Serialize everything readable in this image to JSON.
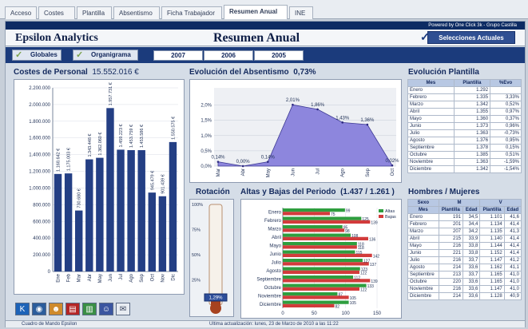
{
  "tabs": [
    "Acceso",
    "Costes",
    "Plantilla",
    "Absentismo",
    "Ficha Trabajador",
    "Resumen Anual",
    "INE"
  ],
  "active_tab": "Resumen Anual",
  "powered_by": "Powered by One Click 3k - Grupo Castilla",
  "app_name": "Epsilon Analytics",
  "page_title": "Resumen Anual",
  "select_button": "Selecciones Actuales",
  "nav": {
    "globales": "Globales",
    "organigrama": "Organigrama",
    "years": [
      "2007",
      "2006",
      "2005"
    ]
  },
  "costes": {
    "title": "Costes de Personal",
    "total": "15.552.016 €",
    "chart_data": {
      "type": "bar",
      "categories": [
        "Ene",
        "Feb",
        "Mar",
        "Abr",
        "May",
        "Jun",
        "Jul",
        "Ago",
        "Sep",
        "Oct",
        "Nov",
        "Dic"
      ],
      "values": [
        1168642,
        1175003,
        730680,
        1343448,
        1362060,
        1957731,
        1459223,
        1453759,
        1453586,
        945479,
        901439,
        1550575
      ],
      "labels": [
        "1.168.642 €",
        "1.175.003 €",
        "730.680 €",
        "1.343.448 €",
        "1.362.060 €",
        "1.957.731 €",
        "1.459.223 €",
        "1.453.759 €",
        "1.453.586 €",
        "945.479 €",
        "901.439 €",
        "1.550.575 €"
      ],
      "yticks": [
        "0",
        "200.000",
        "400.000",
        "600.000",
        "800.000",
        "1.000.000",
        "1.200.000",
        "1.400.000",
        "1.600.000",
        "1.800.000",
        "2.000.000",
        "2.200.000"
      ],
      "ylim": [
        0,
        2200000
      ]
    }
  },
  "absentismo": {
    "title": "Evolución del Absentismo",
    "value": "0,73%",
    "chart_data": {
      "type": "area",
      "categories": [
        "Mar",
        "Abr",
        "May",
        "Jun",
        "Jul",
        "Ago",
        "Sep",
        "Oct"
      ],
      "values": [
        0.14,
        0.0,
        0.14,
        2.01,
        1.86,
        1.43,
        1.36,
        0.02
      ],
      "labels": [
        "0,14%",
        "0,00%",
        "0,14%",
        "2,01%",
        "1,86%",
        "1,43%",
        "1,36%",
        "0,02%"
      ],
      "yticks": [
        "0,0%",
        "0,5%",
        "1,0%",
        "1,5%",
        "2,0%"
      ],
      "ylim": [
        0,
        2.0
      ]
    }
  },
  "plantilla": {
    "title": "Evolución Plantilla",
    "headers": [
      "Mes",
      "Plantilla",
      "%Evo"
    ],
    "rows": [
      [
        "Enero",
        "1.292",
        ""
      ],
      [
        "Febrero",
        "1.335",
        "3,33%"
      ],
      [
        "Marzo",
        "1.342",
        "0,52%"
      ],
      [
        "Abril",
        "1.355",
        "0,97%"
      ],
      [
        "Mayo",
        "1.360",
        "0,37%"
      ],
      [
        "Junio",
        "1.373",
        "0,96%"
      ],
      [
        "Julio",
        "1.363",
        "-0,73%"
      ],
      [
        "Agosto",
        "1.376",
        "0,95%"
      ],
      [
        "Septiembre",
        "1.378",
        "0,15%"
      ],
      [
        "Octubre",
        "1.385",
        "0,51%"
      ],
      [
        "Noviembre",
        "1.363",
        "-1,59%"
      ],
      [
        "Diciembre",
        "1.342",
        "-1,54%"
      ]
    ]
  },
  "rotacion": {
    "title": "Rotación",
    "ticks": [
      "100%",
      "75%",
      "50%",
      "25%"
    ],
    "value": "1,29%",
    "level": 0.0129
  },
  "altas_bajas": {
    "title": "Altas y Bajas del Periodo",
    "subtitle": "(1.437 / 1.261 )",
    "legend": [
      "Altas",
      "Bajas"
    ],
    "chart_data": {
      "type": "bar",
      "orientation": "horizontal",
      "categories": [
        "Enero",
        "Febrero",
        "Marzo",
        "Abril",
        "Mayo",
        "Junio",
        "Julio",
        "Agosto",
        "Septiembre",
        "Octubre",
        "Noviembre",
        "Diciembre"
      ],
      "series": [
        {
          "name": "Altas",
          "values": [
            99,
            125,
            95,
            108,
            118,
            115,
            127,
            123,
            112,
            133,
            87,
            105
          ]
        },
        {
          "name": "Bajas",
          "values": [
            75,
            139,
            98,
            136,
            118,
            142,
            137,
            122,
            139,
            122,
            105,
            82
          ]
        }
      ],
      "xticks": [
        "0",
        "50",
        "100",
        "150"
      ],
      "xlim": [
        0,
        150
      ]
    }
  },
  "hombres": {
    "title": "Hombres / Mujeres",
    "headers": [
      "Sexo",
      "M",
      "V"
    ],
    "subheaders": [
      "Mes",
      "Plantilla",
      "Edad",
      "Plantilla",
      "Edad"
    ],
    "rows": [
      [
        "Enero",
        "191",
        "34,5",
        "1.101",
        "41,6"
      ],
      [
        "Febrero",
        "201",
        "34,4",
        "1.134",
        "41,4"
      ],
      [
        "Marzo",
        "207",
        "34,2",
        "1.135",
        "41,3"
      ],
      [
        "Abril",
        "215",
        "33,9",
        "1.140",
        "41,4"
      ],
      [
        "Mayo",
        "216",
        "33,8",
        "1.144",
        "41,4"
      ],
      [
        "Junio",
        "221",
        "33,8",
        "1.152",
        "41,4"
      ],
      [
        "Julio",
        "216",
        "33,7",
        "1.147",
        "41,2"
      ],
      [
        "Agosto",
        "214",
        "33,6",
        "1.162",
        "41,1"
      ],
      [
        "Septiembre",
        "213",
        "33,7",
        "1.165",
        "41,0"
      ],
      [
        "Octubre",
        "220",
        "33,6",
        "1.165",
        "41,0"
      ],
      [
        "Noviembre",
        "216",
        "33,6",
        "1.147",
        "41,0"
      ],
      [
        "Diciembre",
        "214",
        "33,6",
        "1.128",
        "40,9"
      ]
    ]
  },
  "toolbar": [
    "k-icon",
    "globe-icon",
    "people-icon",
    "pdf-icon",
    "chart-icon",
    "users-icon",
    "report-icon"
  ],
  "status": {
    "left": "Cuadro de Mando Epsilon",
    "center": "Ultima actualización: lunes, 23 de Marzo de 2010 a las 11:22"
  },
  "colors": {
    "bar": "#243f84",
    "area": "#8d86dd",
    "altas": "#2e9e3e",
    "bajas": "#d23b3b",
    "nav": "#1b3b7c"
  }
}
